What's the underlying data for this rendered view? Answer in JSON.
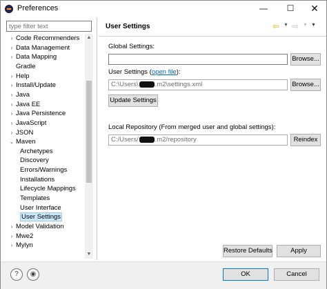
{
  "window": {
    "title": "Preferences",
    "controls": {
      "minimize": "—",
      "maximize": "☐",
      "close": "✕"
    }
  },
  "sidebar": {
    "filter_placeholder": "type filter text",
    "items": [
      {
        "label": "Code Recommenders",
        "arrow": "›",
        "indent": 0
      },
      {
        "label": "Data Management",
        "arrow": "›",
        "indent": 0
      },
      {
        "label": "Data Mapping",
        "arrow": "›",
        "indent": 0
      },
      {
        "label": "Gradle",
        "arrow": "",
        "indent": 0
      },
      {
        "label": "Help",
        "arrow": "›",
        "indent": 0
      },
      {
        "label": "Install/Update",
        "arrow": "›",
        "indent": 0
      },
      {
        "label": "Java",
        "arrow": "›",
        "indent": 0
      },
      {
        "label": "Java EE",
        "arrow": "›",
        "indent": 0
      },
      {
        "label": "Java Persistence",
        "arrow": "›",
        "indent": 0
      },
      {
        "label": "JavaScript",
        "arrow": "›",
        "indent": 0
      },
      {
        "label": "JSON",
        "arrow": "›",
        "indent": 0
      },
      {
        "label": "Maven",
        "arrow": "⌄",
        "indent": 0
      },
      {
        "label": "Archetypes",
        "arrow": "",
        "indent": 1
      },
      {
        "label": "Discovery",
        "arrow": "",
        "indent": 1
      },
      {
        "label": "Errors/Warnings",
        "arrow": "",
        "indent": 1
      },
      {
        "label": "Installations",
        "arrow": "",
        "indent": 1
      },
      {
        "label": "Lifecycle Mappings",
        "arrow": "",
        "indent": 1
      },
      {
        "label": "Templates",
        "arrow": "",
        "indent": 1
      },
      {
        "label": "User Interface",
        "arrow": "",
        "indent": 1
      },
      {
        "label": "User Settings",
        "arrow": "",
        "indent": 1,
        "selected": true
      },
      {
        "label": "Model Validation",
        "arrow": "›",
        "indent": 0
      },
      {
        "label": "Mwe2",
        "arrow": "›",
        "indent": 0
      },
      {
        "label": "Mylyn",
        "arrow": "›",
        "indent": 0
      }
    ]
  },
  "page": {
    "title": "User Settings",
    "global_settings_label": "Global Settings:",
    "global_settings_value": "",
    "browse_label": "Browse...",
    "user_settings_label": "User Settings (",
    "open_file_link": "open file",
    "user_settings_label_end": "):",
    "user_settings_prefix": "C:\\Users\\",
    "user_settings_suffix": ".m2\\settings.xml",
    "update_settings_label": "Update Settings",
    "local_repo_label": "Local Repository (From merged user and global settings):",
    "local_repo_prefix": "C:/Users/",
    "local_repo_suffix": ".m2/repository",
    "reindex_label": "Reindex",
    "restore_defaults_label": "Restore Defaults",
    "apply_label": "Apply"
  },
  "footer": {
    "help_icon": "?",
    "import_icon": "◉",
    "ok_label": "OK",
    "cancel_label": "Cancel"
  },
  "colors": {
    "selection": "#cce8ff",
    "link": "#0066cc",
    "default_button_border": "#0078d7"
  }
}
